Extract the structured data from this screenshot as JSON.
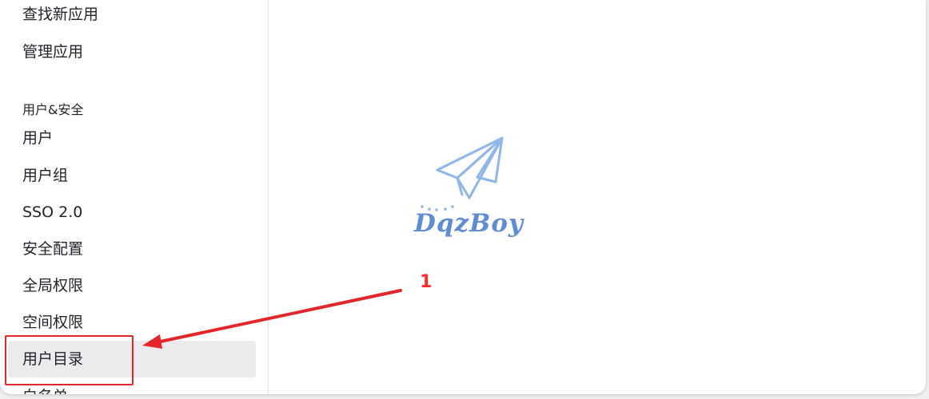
{
  "sidebar": {
    "items_top": [
      {
        "label": "查找新应用"
      },
      {
        "label": "管理应用"
      }
    ],
    "group_label": "用户&安全",
    "items": [
      {
        "label": "用户"
      },
      {
        "label": "用户组"
      },
      {
        "label": "SSO 2.0"
      },
      {
        "label": "安全配置"
      },
      {
        "label": "全局权限"
      },
      {
        "label": "空间权限"
      },
      {
        "label": "用户目录",
        "selected": true
      },
      {
        "label": "白名单"
      }
    ]
  },
  "watermark": {
    "text": "DqzBoy",
    "icon": "paper-plane-icon",
    "color": "#5e8dd1"
  },
  "annotation": {
    "step_number": "1",
    "color": "#e3262a"
  }
}
